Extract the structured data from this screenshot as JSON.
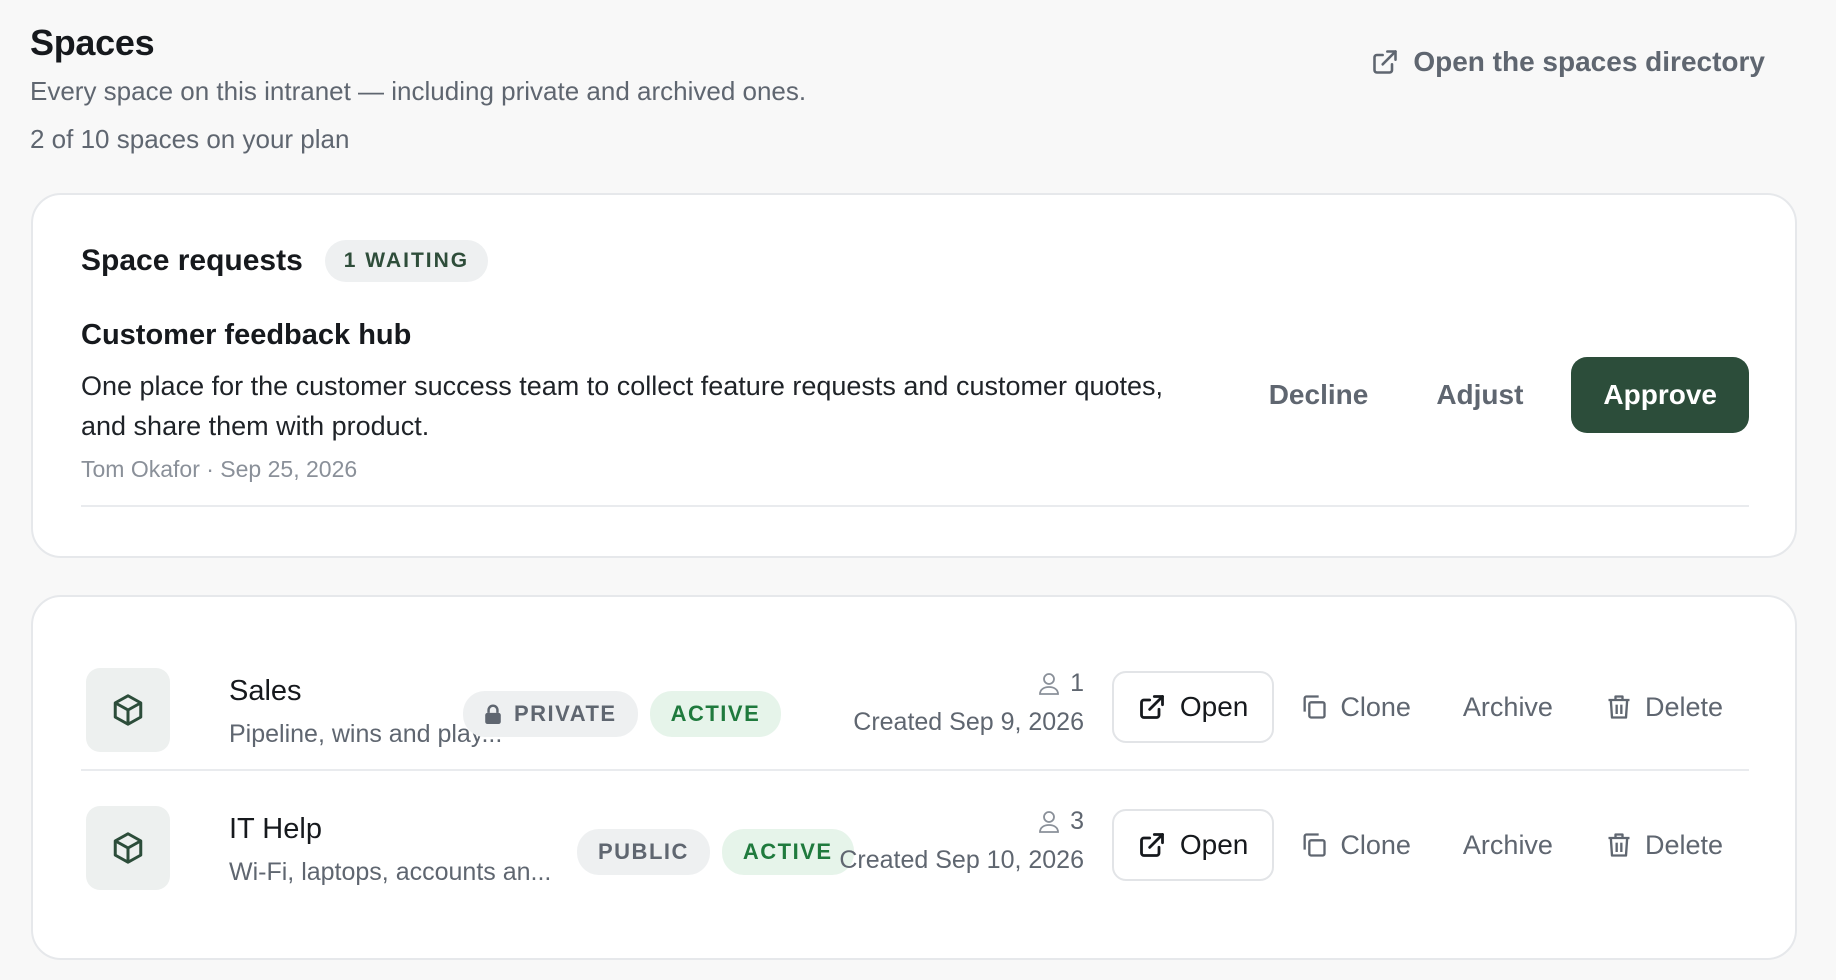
{
  "header": {
    "title": "Spaces",
    "subtitle": "Every space on this intranet — including private and archived ones.",
    "plan_usage": "2 of 10 spaces on your plan",
    "directory_link": "Open the spaces directory"
  },
  "requests": {
    "title": "Space requests",
    "waiting_badge": "1 WAITING",
    "items": [
      {
        "name": "Customer feedback hub",
        "description": "One place for the customer success team to collect feature requests and customer quotes, and share them with product.",
        "meta": "Tom Okafor · Sep 25, 2026",
        "decline_label": "Decline",
        "adjust_label": "Adjust",
        "approve_label": "Approve"
      }
    ]
  },
  "spaces": [
    {
      "name": "Sales",
      "description": "Pipeline, wins and play...",
      "visibility": "PRIVATE",
      "status": "ACTIVE",
      "members": "1",
      "created": "Created Sep 9, 2026",
      "open_label": "Open",
      "clone_label": "Clone",
      "archive_label": "Archive",
      "delete_label": "Delete"
    },
    {
      "name": "IT Help",
      "description": "Wi-Fi, laptops, accounts an...",
      "visibility": "PUBLIC",
      "status": "ACTIVE",
      "members": "3",
      "created": "Created Sep 10, 2026",
      "open_label": "Open",
      "clone_label": "Clone",
      "archive_label": "Archive",
      "delete_label": "Delete"
    }
  ],
  "colors": {
    "accent": "#2c4d3a",
    "active_text": "#1f7a3d",
    "active_bg": "#e6f4ea",
    "muted_text": "#5f6670",
    "page_bg": "#f8f8f8"
  },
  "icons": {
    "directory_link": "external-link-icon",
    "lock": "lock-icon",
    "space": "cube-icon",
    "members": "user-icon",
    "open": "external-link-icon",
    "clone": "copy-icon",
    "delete": "trash-icon"
  }
}
